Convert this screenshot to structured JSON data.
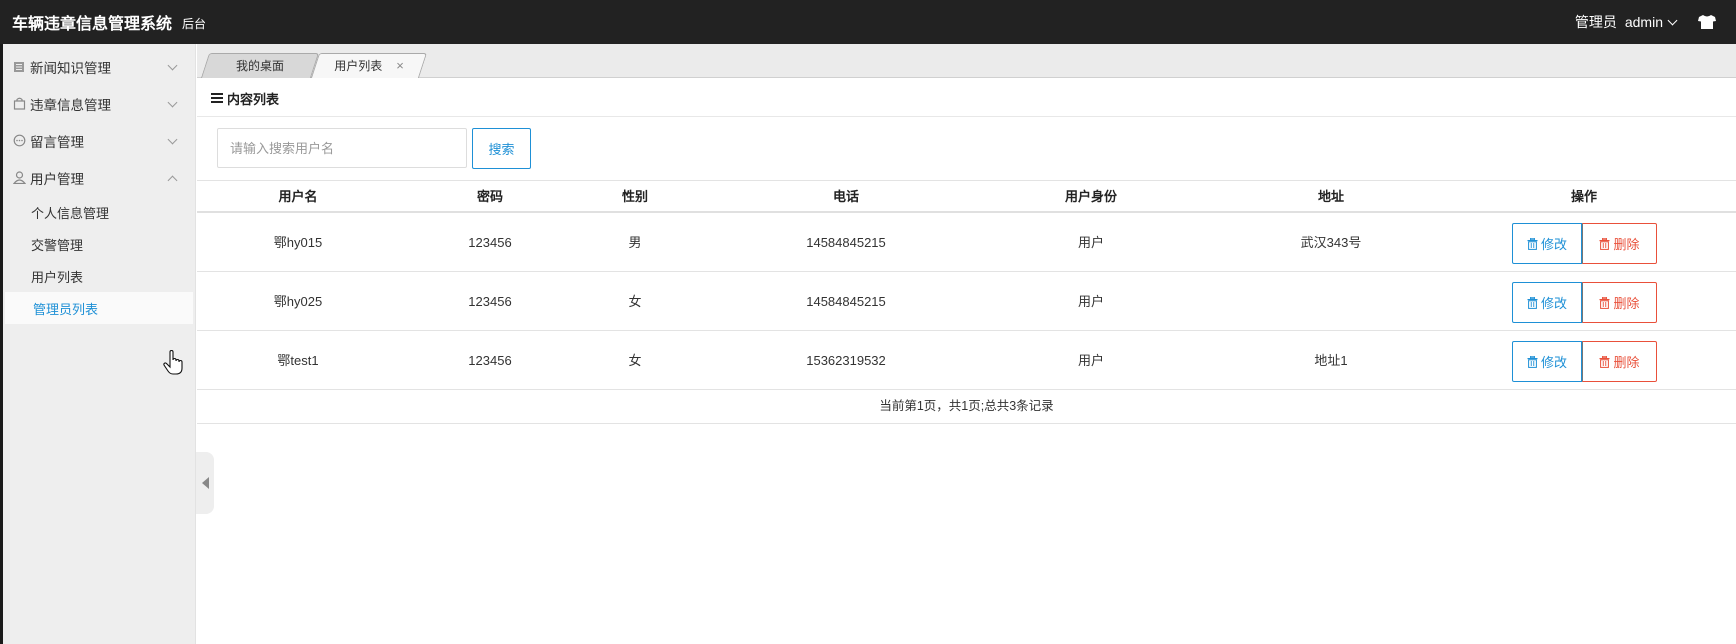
{
  "header": {
    "app_title": "车辆违章信息管理系统",
    "app_subtitle": "后台",
    "role_label": "管理员",
    "user_name": "admin"
  },
  "sidebar": {
    "groups": [
      {
        "label": "新闻知识管理",
        "icon": "document-icon",
        "expanded": false
      },
      {
        "label": "违章信息管理",
        "icon": "bag-icon",
        "expanded": false
      },
      {
        "label": "留言管理",
        "icon": "chat-icon",
        "expanded": false
      },
      {
        "label": "用户管理",
        "icon": "user-icon",
        "expanded": true
      }
    ],
    "subitems": [
      "个人信息管理",
      "交警管理",
      "用户列表",
      "管理员列表"
    ],
    "active_subitem": "管理员列表"
  },
  "tabs": [
    {
      "label": "我的桌面",
      "closable": false
    },
    {
      "label": "用户列表",
      "closable": true,
      "close_glyph": "×"
    }
  ],
  "content": {
    "section_title": "内容列表",
    "search_placeholder": "请输入搜索用户名",
    "search_button": "搜索"
  },
  "table": {
    "headers": [
      "用户名",
      "密码",
      "性别",
      "电话",
      "用户身份",
      "地址",
      "操作"
    ],
    "rows": [
      {
        "username": "鄂hy015",
        "password": "123456",
        "gender": "男",
        "phone": "14584845215",
        "role": "用户",
        "address": "武汉343号"
      },
      {
        "username": "鄂hy025",
        "password": "123456",
        "gender": "女",
        "phone": "14584845215",
        "role": "用户",
        "address": ""
      },
      {
        "username": "鄂test1",
        "password": "123456",
        "gender": "女",
        "phone": "15362319532",
        "role": "用户",
        "address": "地址1"
      }
    ],
    "edit_label": "修改",
    "delete_label": "删除",
    "pagination_text": "当前第1页，共1页;总共3条记录"
  },
  "colors": {
    "topbar_bg": "#222222",
    "accent_blue": "#1e90d6",
    "danger_red": "#e9503a",
    "sidebar_bg": "#eeeeee"
  }
}
